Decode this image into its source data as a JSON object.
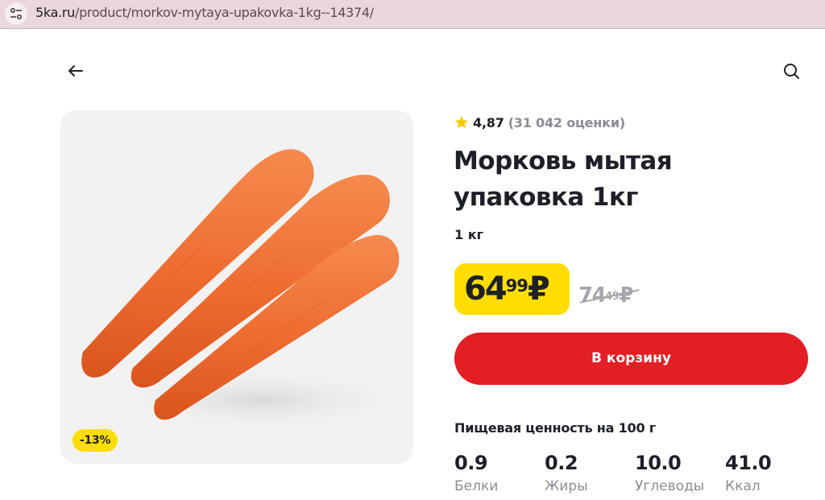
{
  "browser": {
    "url_host": "5ka.ru",
    "url_path": "/product/morkov-mytaya-upakovka-1kg--14374/"
  },
  "icons": {
    "site": "site-settings-icon",
    "back": "arrow-left-icon",
    "search": "search-icon",
    "rating": "star-icon"
  },
  "product": {
    "rating": "4,87",
    "rating_count": "(31 042 оценки)",
    "title": "Морковь мытая упаковка 1кг",
    "weight": "1 кг",
    "discount": "-13%",
    "image_alt": "carrots"
  },
  "price": {
    "current_rub": "64",
    "current_kop": "99",
    "old_rub": "74",
    "old_kop": "49",
    "currency": "₽"
  },
  "cart": {
    "label": "В корзину"
  },
  "nutrition": {
    "title": "Пищевая ценность на 100 г",
    "items": [
      {
        "value": "0.9",
        "label": "Белки"
      },
      {
        "value": "0.2",
        "label": "Жиры"
      },
      {
        "value": "10.0",
        "label": "Углеводы"
      },
      {
        "value": "41.0",
        "label": "Ккал"
      }
    ]
  },
  "colors": {
    "accent_yellow": "#ffdd00",
    "accent_red": "#e31e24",
    "text_dark": "#1e2028",
    "text_muted": "#8a8d95",
    "star": "#ffc800",
    "carrot": "#f0733a"
  }
}
